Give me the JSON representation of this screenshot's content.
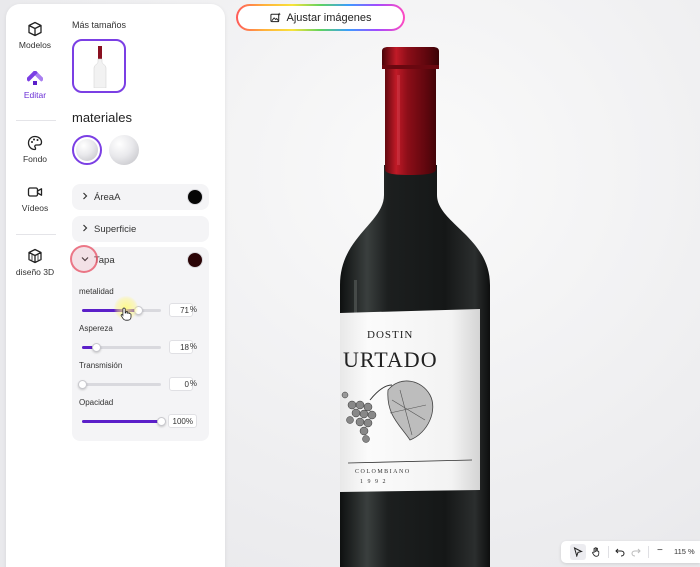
{
  "rail": {
    "items": [
      {
        "label": "Modelos"
      },
      {
        "label": "Editar"
      },
      {
        "label": "Fondo"
      },
      {
        "label": "Vídeos"
      },
      {
        "label": "diseño 3D"
      }
    ]
  },
  "sizes": {
    "label": "Más tamaños"
  },
  "materials": {
    "heading": "materiales"
  },
  "accordions": {
    "area": {
      "label": "ÁreaA",
      "color": "#050505"
    },
    "surface": {
      "label": "Superficie"
    },
    "cap": {
      "label": "Tapa",
      "color": "#2a0406"
    }
  },
  "sliders": {
    "metallic": {
      "label": "metalidad",
      "value": "71",
      "unit": "%",
      "fraction": 0.71
    },
    "roughness": {
      "label": "Aspereza",
      "value": "18",
      "unit": "%",
      "fraction": 0.18
    },
    "transmission": {
      "label": "Transmisión",
      "value": "0",
      "unit": "%",
      "fraction": 0.0
    },
    "opacity": {
      "label": "Opacidad",
      "value": "100%",
      "fraction": 1.0
    }
  },
  "top_button": {
    "label": "Ajustar imágenes"
  },
  "label_art": {
    "brand": "DOSTIN",
    "name": "URTADO",
    "sub1": "COLOMBIANO",
    "sub2": "1 9 9 2"
  },
  "toolbar": {
    "zoom": "115 %",
    "zoom_out": "−"
  },
  "colors": {
    "accent": "#6b2fd6",
    "slider_fill": "#5b1fc9",
    "capsule": "#9e0f1a",
    "glass": "#1a1c1c"
  }
}
